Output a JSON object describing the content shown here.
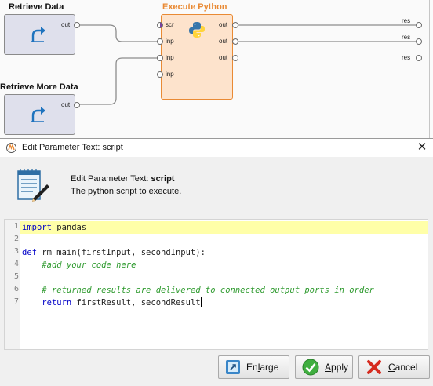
{
  "canvas": {
    "operators": {
      "retrieve_data": {
        "title": "Retrieve Data",
        "out_port": "out"
      },
      "retrieve_more": {
        "title": "Retrieve More Data",
        "out_port": "out"
      },
      "execute_python": {
        "title": "Execute Python",
        "input_ports": [
          "scr",
          "inp",
          "inp",
          "inp"
        ],
        "output_ports": [
          "out",
          "out",
          "out"
        ]
      }
    },
    "result_ports": [
      "res",
      "res",
      "res"
    ],
    "colors": {
      "active_title": "#e98a34",
      "operator_bg": "#dfe0ec",
      "active_bg": "#fde3cc"
    }
  },
  "dialog": {
    "title": "Edit Parameter Text: script",
    "close_symbol": "✕",
    "header_title_prefix": "Edit Parameter Text: ",
    "header_title_param": "script",
    "header_description": "The python script to execute."
  },
  "editor": {
    "lines": [
      {
        "number": "1",
        "tokens": [
          {
            "t": "kw",
            "v": "import"
          },
          {
            "t": "tx",
            "v": " pandas"
          }
        ]
      },
      {
        "number": "2",
        "tokens": []
      },
      {
        "number": "3",
        "tokens": [
          {
            "t": "kw",
            "v": "def"
          },
          {
            "t": "tx",
            "v": " rm_main(firstInput, secondInput):"
          }
        ]
      },
      {
        "number": "4",
        "tokens": [
          {
            "t": "tx",
            "v": "    "
          },
          {
            "t": "cm",
            "v": "#add your code here"
          }
        ]
      },
      {
        "number": "5",
        "tokens": []
      },
      {
        "number": "6",
        "tokens": [
          {
            "t": "tx",
            "v": "    "
          },
          {
            "t": "cm",
            "v": "# returned results are delivered to connected output ports in order"
          }
        ]
      },
      {
        "number": "7",
        "tokens": [
          {
            "t": "tx",
            "v": "    "
          },
          {
            "t": "kw",
            "v": "return"
          },
          {
            "t": "tx",
            "v": " firstResult, secondResult"
          }
        ]
      }
    ],
    "highlighted_line": "1"
  },
  "buttons": {
    "enlarge": {
      "label": "Enlarge",
      "mnemonic_index": 2,
      "icon": "enlarge-icon"
    },
    "apply": {
      "label": "Apply",
      "mnemonic_index": 0,
      "icon": "checkmark-icon"
    },
    "cancel": {
      "label": "Cancel",
      "mnemonic_index": 0,
      "icon": "cross-icon"
    }
  }
}
